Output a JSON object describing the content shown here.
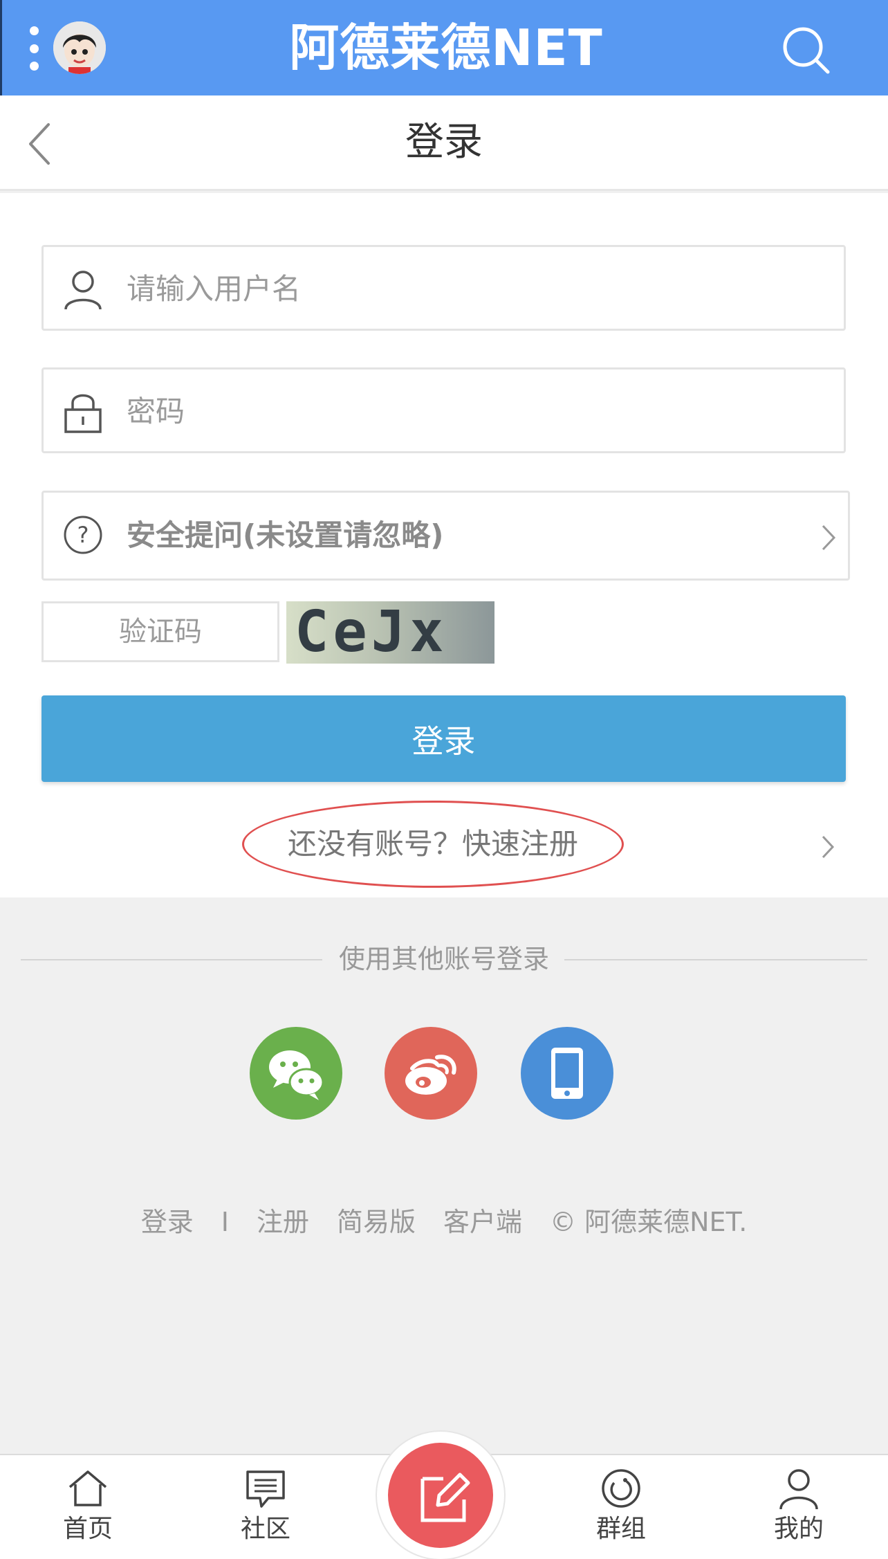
{
  "header": {
    "brand": "阿德莱德NET"
  },
  "titlebar": {
    "title": "登录"
  },
  "form": {
    "username_placeholder": "请输入用户名",
    "password_placeholder": "密码",
    "security_question_label": "安全提问(未设置请忽略)",
    "captcha_placeholder": "验证码",
    "captcha_text": "CeJx",
    "login_button": "登录",
    "register_link": "还没有账号？快速注册"
  },
  "other_login": {
    "title": "使用其他账号登录",
    "options": [
      {
        "icon": "wechat-icon",
        "color": "#6ab04c"
      },
      {
        "icon": "weibo-icon",
        "color": "#e0665a"
      },
      {
        "icon": "phone-icon",
        "color": "#4a8fd8"
      }
    ]
  },
  "footer": {
    "links": [
      "登录",
      "I",
      "注册",
      "简易版",
      "客户端",
      "© 阿德莱德NET."
    ]
  },
  "bottom_nav": {
    "items": [
      {
        "label": "首页",
        "icon": "home-icon"
      },
      {
        "label": "社区",
        "icon": "chat-icon"
      },
      {
        "label": "群组",
        "icon": "group-icon"
      },
      {
        "label": "我的",
        "icon": "user-icon"
      }
    ],
    "fab_icon": "edit-icon"
  },
  "colors": {
    "topbar": "#5899f2",
    "login_button": "#4aa5d9",
    "highlight_ring": "#e05050",
    "fab": "#ea5a5e"
  }
}
